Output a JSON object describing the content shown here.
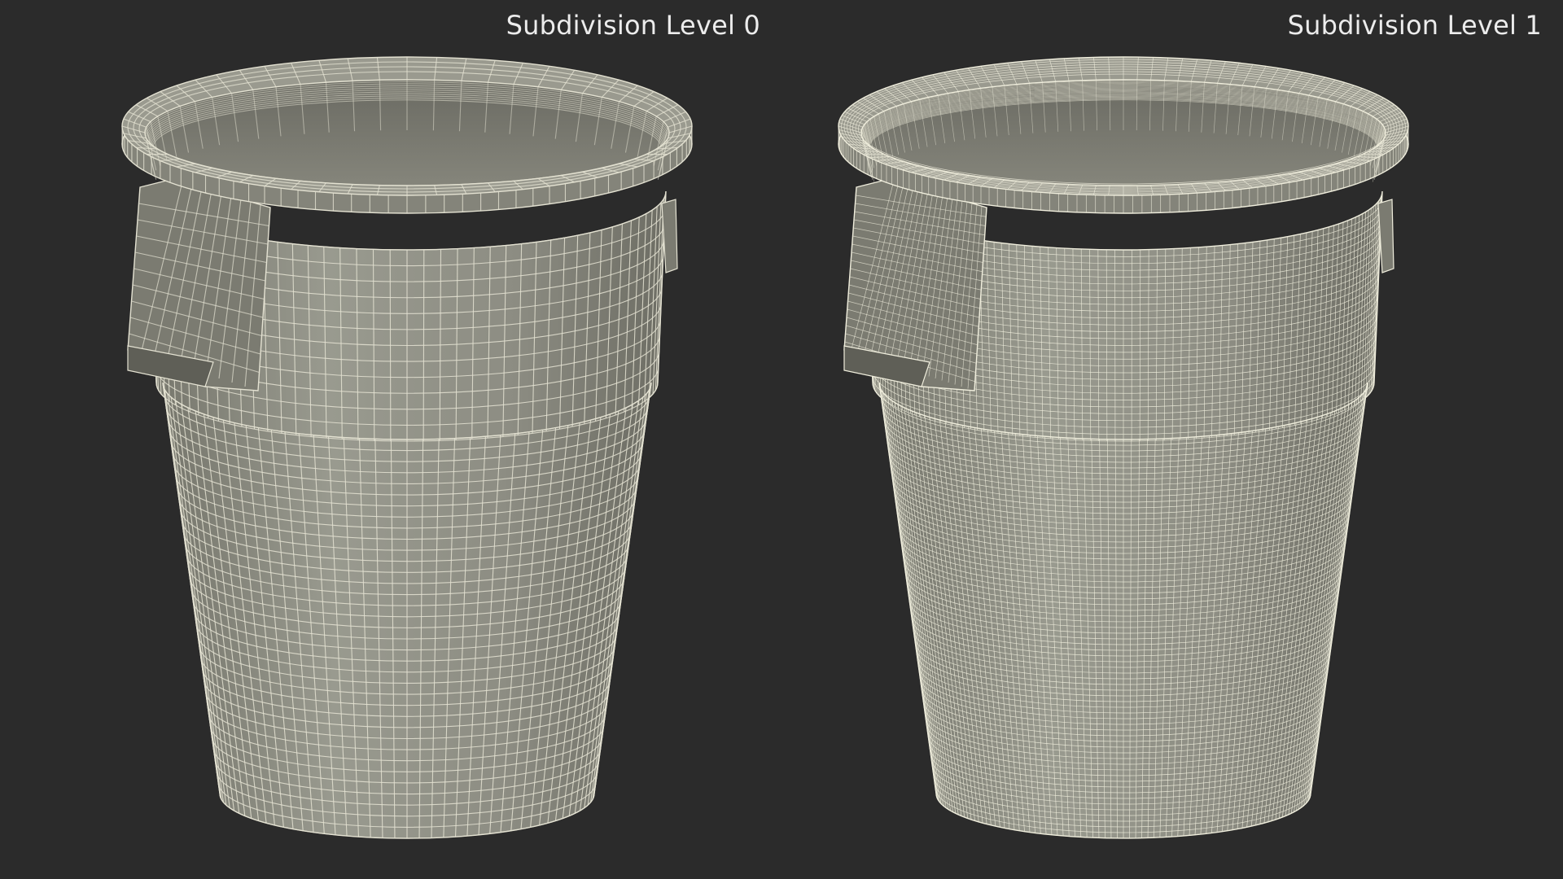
{
  "panels": [
    {
      "label": "Subdivision Level 0",
      "grid_density": "coarse"
    },
    {
      "label": "Subdivision Level 1",
      "grid_density": "fine"
    }
  ],
  "colors": {
    "background": "#2b2b2b",
    "surface": "#8b8b80",
    "surface_dark": "#6f6f66",
    "surface_light": "#a3a398",
    "wire_coarse": "#e4e2d2",
    "wire_fine": "#f0eedd",
    "label_text": "#ececec"
  }
}
